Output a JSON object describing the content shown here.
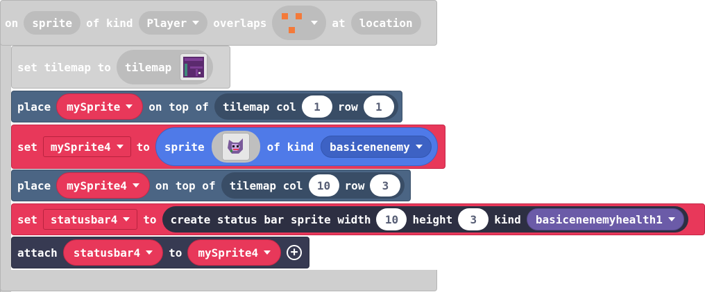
{
  "event": {
    "on": "on",
    "sprite_var": "sprite",
    "of_kind": "of kind",
    "kind": "Player",
    "overlaps": "overlaps",
    "at": "at",
    "location_var": "location"
  },
  "s1": {
    "set_tilemap_to": "set tilemap to",
    "tilemap": "tilemap"
  },
  "s2": {
    "place": "place",
    "sprite": "mySprite",
    "on_top_of": "on top of",
    "tilemap_col": "tilemap col",
    "col": "1",
    "row_label": "row",
    "row": "1"
  },
  "s3": {
    "set": "set",
    "var": "mySprite4",
    "to": "to",
    "sprite_label": "sprite",
    "of_kind": "of kind",
    "kind": "basicenenemy"
  },
  "s4": {
    "place": "place",
    "sprite": "mySprite4",
    "on_top_of": "on top of",
    "tilemap_col": "tilemap col",
    "col": "10",
    "row_label": "row",
    "row": "3"
  },
  "s5": {
    "set": "set",
    "var": "statusbar4",
    "to": "to",
    "create": "create status bar sprite width",
    "width": "10",
    "height_label": "height",
    "height": "3",
    "kind_label": "kind",
    "kind": "basicenenemyhealth1"
  },
  "s6": {
    "attach": "attach",
    "bar": "statusbar4",
    "to": "to",
    "sprite": "mySprite4"
  },
  "colors": {
    "event_gray": "#cfcfcf",
    "scene_blue": "#4b6584",
    "sprite_red": "#e8385a",
    "sprite_blue": "#4f7ae8",
    "statusbar_navy": "#373a52",
    "kind_purple": "#6b5ba8",
    "tile_orange": "#f47a3a"
  }
}
